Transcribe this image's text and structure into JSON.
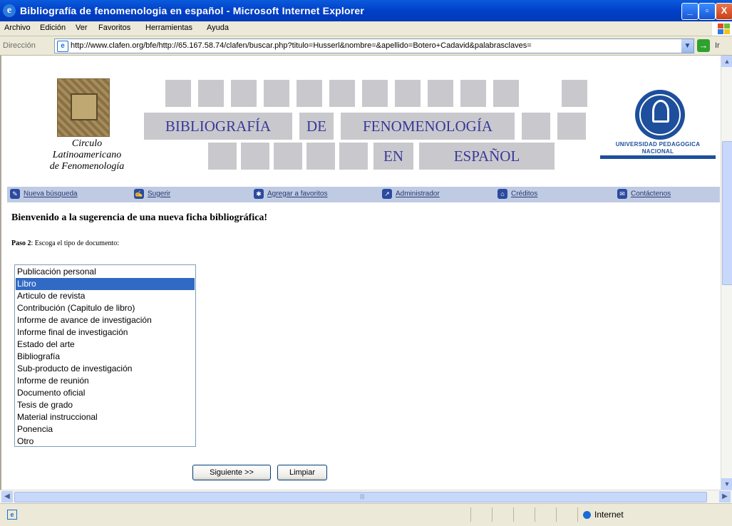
{
  "window": {
    "title": "Bibliografía de fenomenologia en español - Microsoft Internet Explorer",
    "controls": [
      "_",
      "▫",
      "X"
    ]
  },
  "menu": [
    "Archivo",
    "Edición",
    "Ver",
    "Favoritos",
    "Herramientas",
    "Ayuda"
  ],
  "address": {
    "label": "Dirección",
    "url": "http://www.clafen.org/bfe/http://65.167.58.74/clafen/buscar.php?titulo=Husserl&nombre=&apellido=Botero+Cadavid&palabrasclaves=",
    "after_go": "Ir"
  },
  "header": {
    "circulo_lines": [
      "Circulo",
      "Latinoamericano",
      "de Fenomenología"
    ],
    "title_words_row1": [
      "BIBLIOGRAFÍA",
      "DE",
      "FENOMENOLOGÍA"
    ],
    "title_words_row2": [
      "EN",
      "ESPAÑOL"
    ],
    "university_lines": [
      "UNIVERSIDAD PEDAGOGICA",
      "NACIONAL"
    ]
  },
  "nav": [
    {
      "label": "Nueva búsqueda",
      "icon": "pencil-icon"
    },
    {
      "label": "Sugerir",
      "icon": "sign-icon"
    },
    {
      "label": "Agregar a favoritos",
      "icon": "star-icon"
    },
    {
      "label": "Administrador",
      "icon": "arrow-icon"
    },
    {
      "label": "Créditos",
      "icon": "home-icon"
    },
    {
      "label": "Contáctenos",
      "icon": "envelope-icon"
    }
  ],
  "main": {
    "welcome": "Bienvenido a la sugerencia de una nueva ficha bibliográfica!",
    "step_label": "Paso 2",
    "step_text": ": Escoga el tipo de documento:",
    "options": [
      "Publicación personal",
      "Libro",
      "Articulo de revista",
      "Contribución (Capitulo de libro)",
      "Informe de avance de investigación",
      "Informe final de investigación",
      "Estado del arte",
      "Bibliografía",
      "Sub-producto de investigación",
      "Informe de reunión",
      "Documento oficial",
      "Tesis de grado",
      "Material instruccional",
      "Ponencia",
      "Otro"
    ],
    "selected_option": "Libro",
    "next_button": "Siguiente >>",
    "clear_button": "Limpiar"
  },
  "status": {
    "zone": "Internet"
  },
  "colors": {
    "titlebar": "#0040c8",
    "navbar": "#bfcbe3",
    "title_text": "#38389a",
    "tile": "#c9c9cd",
    "selection": "#316ac5"
  }
}
